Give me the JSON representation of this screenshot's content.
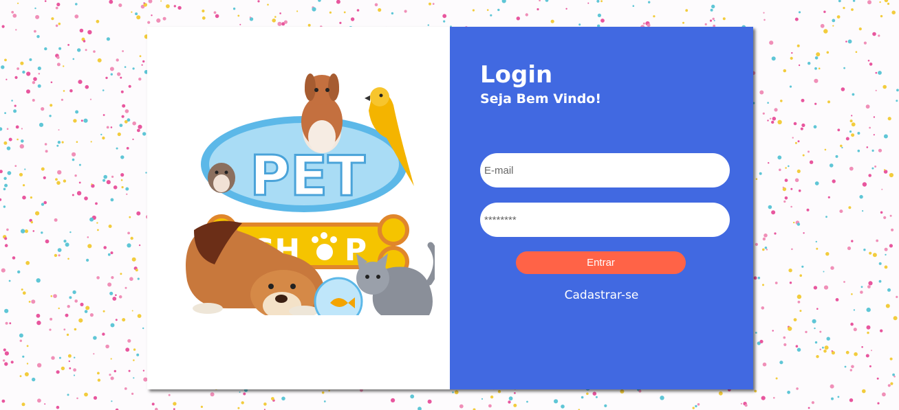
{
  "logo": {
    "line1": "PET",
    "line2": "SH",
    "line2_end": "P"
  },
  "login": {
    "title": "Login",
    "subtitle": "Seja Bem Vindo!",
    "email_placeholder": "E-mail",
    "password_placeholder": "********",
    "submit_label": "Entrar",
    "register_label": "Cadastrar-se"
  },
  "colors": {
    "panel": "#4169e1",
    "button": "#ff6347",
    "confetti": [
      "#e8569e",
      "#5fc6d6",
      "#f2cc3d",
      "#f08fb8"
    ]
  }
}
